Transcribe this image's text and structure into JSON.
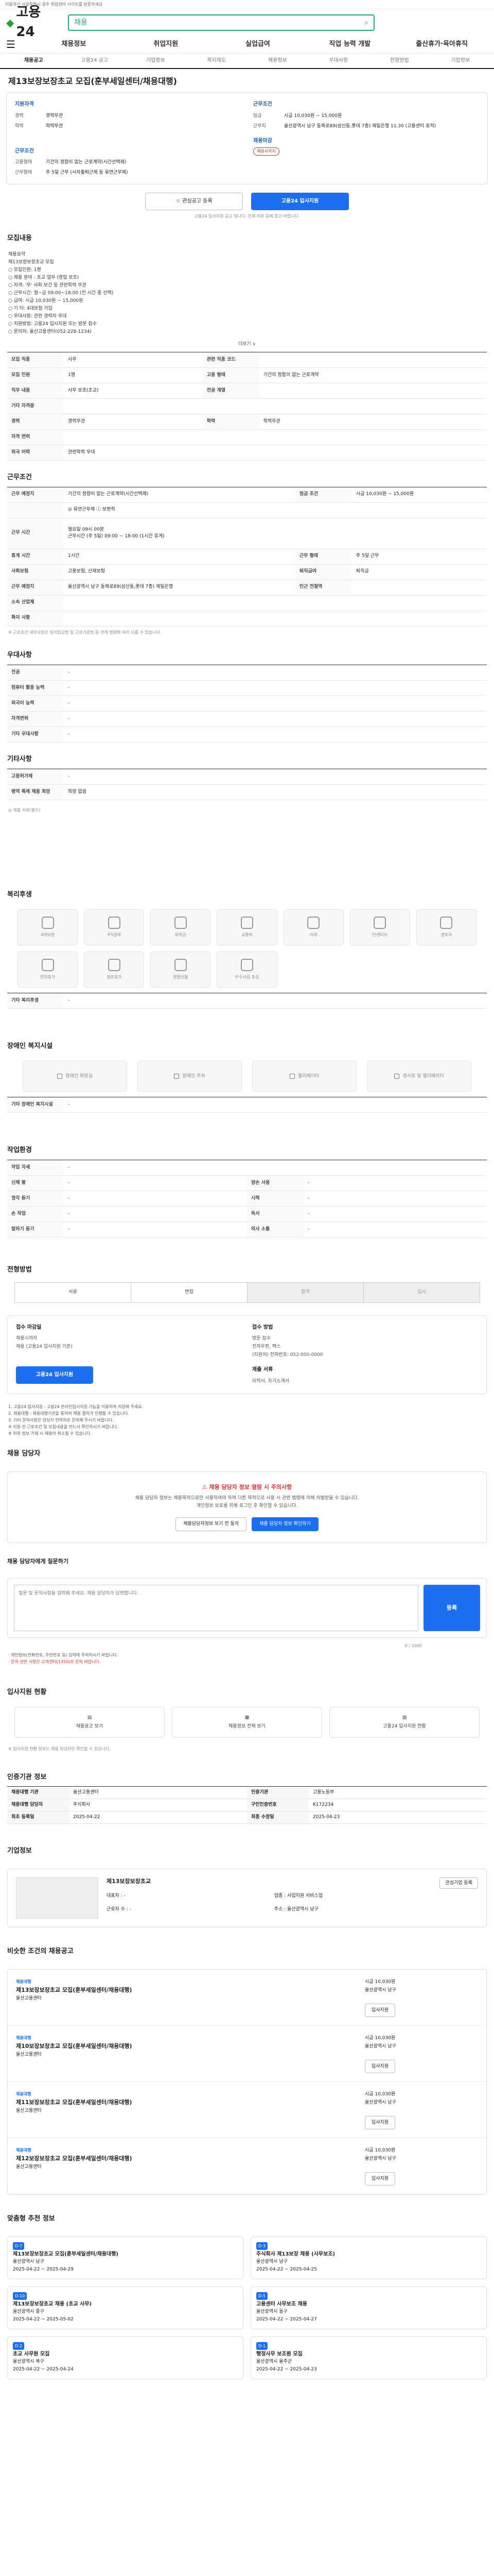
{
  "topbar": {
    "text": "이동하기 서울특별시 광주 취업센터 사이트를 방문하세요"
  },
  "header": {
    "logo": "고용24",
    "search_label": "채용",
    "search_icon": "search-icon"
  },
  "gnb": {
    "menu_icon": "hamburger-icon",
    "items": [
      "채용정보",
      "취업지원",
      "실업급여",
      "직업 능력 개발",
      "출산휴가·육아휴직"
    ]
  },
  "tabs": [
    "채용공고",
    "고용24 공고",
    "기업정보",
    "복지제도",
    "채용정보",
    "우대사항",
    "전형방법",
    "기업정보"
  ],
  "title": "제13보장보장초교 모집(훈부세일센터/채용대행)",
  "summary": {
    "left_head": "지원자격",
    "left": [
      {
        "k": "경력",
        "v": "경력무관"
      },
      {
        "k": "학력",
        "v": "학력무관"
      }
    ],
    "left_head2": "근무조건",
    "left2": [
      {
        "k": "고용형태",
        "v": "기간의 정함이 없는 근로계약(시간선택제)"
      },
      {
        "k": "근무형태",
        "v": "주 5일 근무 (시차출퇴근제 등 유연근무제)"
      }
    ],
    "right_head": "근무조건",
    "right": [
      {
        "k": "임금",
        "v": "시급 10,030원 ~ 15,000원"
      },
      {
        "k": "근무지",
        "v": "울산광역시 남구 동북로89(삼산동,롯데 7층) 제일은행 11.30 (고용센터 호적)"
      }
    ],
    "right_head2": "채용마감",
    "badge": "채용시까지"
  },
  "buttons": {
    "scrap": "관심공고 등록",
    "apply": "고용24 입사지원"
  },
  "note": "고용24 입사지원 공고 입니다. 인재 지원 등에 참고 바랍니다.",
  "job": {
    "title": "모집내용",
    "body": "채용요약\n제13보장보장초교 모집\n○ 모집인원: 1명\n○ 채용 분야 : 초교 업무 (영업 보조)\n○ 자격: '우' 사회·보건 등 관련학력 무관\n○ 근무시간: 월~금 09:00~18:00 (전 시간 중 선택)\n○ 급여: 시급 10,030원 ~ 15,000원\n○ 기 타: 4대보험 가입\n○ 우대사항: 관련 경력자 우대\n○ 지원방법: 고용24 입사지원 또는 방문 접수\n○ 문의처: 울산고용센터(052-228-1234)",
    "more": "더보기 ∨"
  },
  "detail": [
    {
      "k": "모집 직종",
      "v": "사무",
      "k2": "관련 직종 코드",
      "v2": ""
    },
    {
      "k": "모집 인원",
      "v": "1명",
      "k2": "고용 형태",
      "v2": "기간의 정함이 없는 근로계약"
    },
    {
      "k": "직무 내용",
      "v": "사무 보조(초교)",
      "k2": "전공 계열",
      "v2": ""
    },
    {
      "k": "기타 자격증",
      "v": "",
      "k2": "",
      "v2": ""
    },
    {
      "k": "경력",
      "v": "경력무관",
      "k2": "학력",
      "v2": "학력무관"
    },
    {
      "k": "자격 면허",
      "v": "",
      "k2": "",
      "v2": ""
    },
    {
      "k": "외국 어학",
      "v": "관련학력 우대",
      "k2": "",
      "v2": ""
    }
  ],
  "work": {
    "title": "근무조건",
    "rows": [
      {
        "k": "근무 예정지",
        "v": "기간의 정함이 없는 근로계약(시간선택제)",
        "k2": "임금 조건",
        "v2": "시급 10,030원 ~ 15,000원"
      },
      {
        "k": "",
        "v": "◎ 유연근무제 ⓘ 보편적",
        "k2": "",
        "v2": ""
      },
      {
        "k": "근무 시간",
        "v": "월요일 09시 00분\n근무시간 (주 5일) 09:00 ~ 18:00 (1시간 휴게)",
        "k2": "",
        "v2": ""
      },
      {
        "k": "",
        "v": "",
        "k2": "",
        "v2": ""
      },
      {
        "k": "휴게 시간",
        "v": "1시간",
        "k2": "근무 형태",
        "v2": "주 5일 근무"
      },
      {
        "k": "사회보험",
        "v": "고용보험, 산재보험",
        "k2": "퇴직급여",
        "v2": "퇴직금"
      },
      {
        "k": "근무 예정지",
        "v": "울산광역시 남구 동북로89(삼산동,롯데 7층) 제일은행",
        "k2": "인근 전철역",
        "v2": ""
      },
      {
        "k": "소속 산업체",
        "v": "",
        "k2": "",
        "v2": ""
      },
      {
        "k": "특이 사항",
        "v": "",
        "k2": "",
        "v2": ""
      }
    ],
    "small": "※ 근로조건 세부사항은 최저임금법 및 근로기준법 등 관계 법령에 따라 다를 수 있습니다."
  },
  "pref": {
    "title": "우대사항",
    "rows": [
      {
        "k": "전공",
        "v": "-"
      },
      {
        "k": "컴퓨터 활용 능력",
        "v": "-"
      },
      {
        "k": "외국어 능력",
        "v": "-"
      },
      {
        "k": "자격면허",
        "v": "-"
      },
      {
        "k": "기타 우대사항",
        "v": "-"
      }
    ]
  },
  "other": {
    "title": "기타사항",
    "rows": [
      {
        "k": "고용허가제",
        "v": "-"
      },
      {
        "k": "병역 특례 채용 희망",
        "v": "희망 없음"
      }
    ]
  },
  "doc": {
    "title": "필요 서류",
    "text": "◎ 제출 서류(필수)"
  },
  "welfare": {
    "title": "복리후생",
    "items": [
      "4대보험",
      "주5일제",
      "퇴직금",
      "교통비",
      "식대",
      "인센티브",
      "경조사",
      "연차휴가",
      "경조휴가",
      "명절선물",
      "우수사원 포상"
    ],
    "extra_k": "기타 복리후생",
    "extra_v": "-"
  },
  "disabled": {
    "title": "장애인 복지시설",
    "items": [
      "장애인 화장실",
      "장애인 주차",
      "엘리베이터",
      "경사로 및 엘리베이터"
    ],
    "extra_k": "기타 장애인 복지시설",
    "extra_v": "-"
  },
  "workenv": {
    "title": "작업환경",
    "rows": [
      {
        "k": "작업 자세",
        "v": "-",
        "k2": "",
        "v2": ""
      },
      {
        "k": "신체 팔",
        "v": "-",
        "k2": "양손 사용",
        "v2": "-"
      },
      {
        "k": "청각 듣기",
        "v": "-",
        "k2": "시력",
        "v2": "-"
      },
      {
        "k": "손 작업",
        "v": "-",
        "k2": "독서",
        "v2": "-"
      },
      {
        "k": "말하기 듣기",
        "v": "-",
        "k2": "의사 소통",
        "v2": "-"
      }
    ]
  },
  "process": {
    "title": "전형방법",
    "steps": [
      "서류",
      "면접",
      "합격",
      "입사"
    ]
  },
  "applyinfo": {
    "title1": "접수 마감일",
    "v1": "채용시까지",
    "sub1": "채용 (고용24 입사지원 기준)",
    "btn": "고용24 입사지원",
    "title2": "접수 방법",
    "v2a": "방문 접수",
    "v2b": "전자우편, 팩스",
    "v2c": "(지원처) 전화번호: 052-000-0000",
    "title3": "제출 서류",
    "v3": "이력서, 자기소개서"
  },
  "bullets": [
    "1. 고용24 입사지원 : 고용24 온라인입사지원 기능을 이용하여 지원해 주세요.",
    "2. 채용대행 : 채용대행기관을 통하여 채용 절차가 진행될 수 있습니다.",
    "3. 기타 문의사항은 담당자 연락처로 문의해 주시기 바랍니다.",
    "※ 지원 전 근로조건 및 모집내용을 반드시 확인하시기 바랍니다.",
    "※ 허위 정보 기재 시 채용이 취소될 수 있습니다."
  ],
  "contact": {
    "title": "채용 담당자",
    "warn": "채용 담당자 정보 열람 시 주의사항",
    "p1": "채용 담당자 정보는 채용목적으로만 사용하여야 하며 다른 목적으로 사용 시 관련 법령에 의해 처벌받을 수 있습니다.",
    "p2": "개인정보 보호를 위해 로그인 후 확인할 수 있습니다.",
    "b1": "채용담당자정보 보기 전 동의",
    "b2": "채용 담당자 정보 확인하기"
  },
  "inquiry": {
    "title": "채용 담당자에게 질문하기",
    "placeholder": "질문 및 문의사항을 입력해 주세요. 채용 담당자가 답변합니다.",
    "count": "0 / 1000",
    "btn": "등록"
  },
  "inq_notes": [
    "· 개인정보(전화번호, 주민번호 등) 입력에 주의하시기 바랍니다.",
    "· 문의 관련 사항은 고객센터(1350)로 문의 바랍니다."
  ],
  "links": {
    "title": "입사지원 현황",
    "items": [
      "채용공고 보기",
      "채용정보 전체 보기",
      "고용24 입사지원 현황"
    ]
  },
  "links_note": "※ 입사지원 현황 정보는 채용 담당자만 확인할 수 있습니다.",
  "rec_info": {
    "title": "인증기관 정보",
    "rows": [
      {
        "k": "채용대행 기관",
        "v": "울산고용센터",
        "k2": "인증기관",
        "v2": "고용노동부"
      },
      {
        "k": "채용대행 담당자",
        "v": "주식회사",
        "k2": "구인인증번호",
        "v2": "K172234"
      },
      {
        "k": "최초 등록일",
        "v": "2025-04-22",
        "k2": "최종 수정일",
        "v2": "2025-04-23"
      }
    ]
  },
  "company": {
    "title": "기업정보",
    "name": "제13보장보장초교",
    "k1": "대표자",
    "v1": "-",
    "k2": "업종",
    "v2": "사업지원 서비스업",
    "k3": "근로자 수",
    "v3": "-",
    "k4": "주소",
    "v4": "울산광역시 남구",
    "follow": "관심기업 등록"
  },
  "similar": {
    "title": "비슷한 조건의 채용공고",
    "items": [
      {
        "tag": "채용대행",
        "t": "제13보장보장초교 모집(훈부세일센터/채용대행)",
        "c": "울산고용센터",
        "r1": "시급 10,030원",
        "r2": "울산광역시 남구",
        "apply": "입사지원"
      },
      {
        "tag": "채용대행",
        "t": "제10보장보장초교 모집(훈부세일센터/채용대행)",
        "c": "울산고용센터",
        "r1": "시급 10,030원",
        "r2": "울산광역시 남구",
        "apply": "입사지원"
      },
      {
        "tag": "채용대행",
        "t": "제11보장보장초교 모집(훈부세일센터/채용대행)",
        "c": "울산고용센터",
        "r1": "시급 10,030원",
        "r2": "울산광역시 남구",
        "apply": "입사지원"
      },
      {
        "tag": "채용대행",
        "t": "제12보장보장초교 모집(훈부세일센터/채용대행)",
        "c": "울산고용센터",
        "r1": "시급 10,030원",
        "r2": "울산광역시 남구",
        "apply": "입사지원"
      }
    ]
  },
  "recommend": {
    "title": "맞춤형 추천 정보",
    "items": [
      {
        "dd": "D-7",
        "t": "제13보장보장초교 모집(훈부세일센터/채용대행)",
        "c": "울산광역시 남구",
        "p": "2025-04-22 ~ 2025-04-29"
      },
      {
        "dd": "D-3",
        "t": "주식회사 제13보장 채용 (사무보조)",
        "c": "울산광역시 남구",
        "p": "2025-04-22 ~ 2025-04-25"
      },
      {
        "dd": "D-10",
        "t": "제13보장보장초교 채용 (초교 사무)",
        "c": "울산광역시 중구",
        "p": "2025-04-22 ~ 2025-05-02"
      },
      {
        "dd": "D-5",
        "t": "고용센터 사무보조 채용",
        "c": "울산광역시 동구",
        "p": "2025-04-22 ~ 2025-04-27"
      },
      {
        "dd": "D-2",
        "t": "초교 사무원 모집",
        "c": "울산광역시 북구",
        "p": "2025-04-22 ~ 2025-04-24"
      },
      {
        "dd": "D-1",
        "t": "행정사무 보조원 모집",
        "c": "울산광역시 울주군",
        "p": "2025-04-22 ~ 2025-04-23"
      }
    ]
  }
}
